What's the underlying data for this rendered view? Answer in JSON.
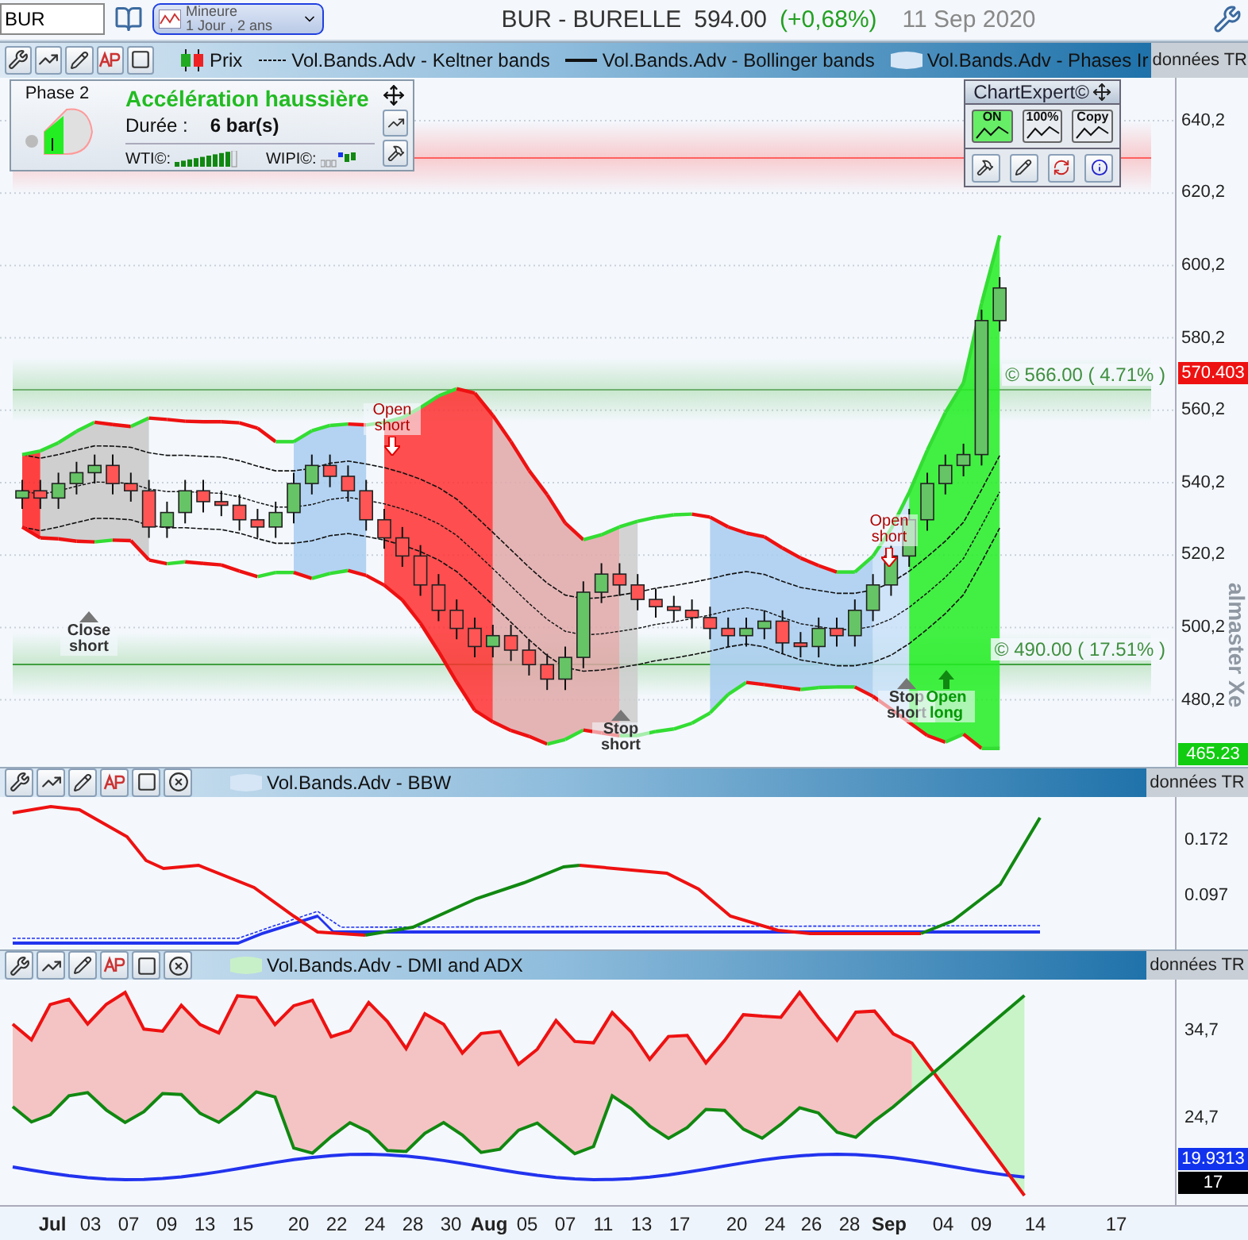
{
  "header": {
    "symbol": "BUR",
    "timeframe": {
      "label": "Mineure",
      "detail": "1 Jour , 2 ans"
    },
    "title": "BUR - BURELLE",
    "price": "594.00",
    "change": "(+0,68%)",
    "date": "11 Sep 2020"
  },
  "main_pane": {
    "legend": [
      {
        "kind": "candles",
        "label": "Prix"
      },
      {
        "kind": "dashed",
        "label": "Vol.Bands.Adv - Keltner bands"
      },
      {
        "kind": "solid",
        "label": "Vol.Bands.Adv - Bollinger bands"
      },
      {
        "kind": "area",
        "label": "Vol.Bands.Adv - Phases Ir"
      }
    ],
    "data_source": "données TR",
    "phase_panel": {
      "phase": "Phase 2",
      "title": "Accélération haussière",
      "duration_label": "Durée :",
      "duration": "6 bar(s)",
      "wti": {
        "label": "WTI©:",
        "level": 0.9
      },
      "wipi_label": "WIPI©:"
    },
    "chart_expert": {
      "title": "ChartExpert©",
      "buttons": [
        {
          "label": "ON",
          "on": true
        },
        {
          "label": "100%",
          "on": false
        },
        {
          "label": "Copy",
          "on": false
        }
      ]
    },
    "levels": [
      {
        "kind": "target",
        "label": "© 566.00 ( 4.71% )"
      },
      {
        "kind": "stop",
        "label": "© 490.00 ( 17.51% )"
      }
    ],
    "signals": [
      {
        "kind": "close_short",
        "label": "Close short"
      },
      {
        "kind": "open_short",
        "label": "Open short"
      },
      {
        "kind": "stop_short",
        "label": "Stop short"
      },
      {
        "kind": "open_short",
        "label": "Open short"
      },
      {
        "kind": "stop_short",
        "label": "Stop short"
      },
      {
        "kind": "open_long",
        "label": "Open long"
      }
    ],
    "y_axis": [
      "640,2",
      "620,2",
      "600,2",
      "580,2",
      "560,2",
      "540,2",
      "520,2",
      "500,2",
      "480,2"
    ],
    "price_tags": [
      {
        "kind": "resistance",
        "label": "570.403"
      },
      {
        "kind": "support",
        "label": "465.23"
      }
    ],
    "vendor_label": "almaster Xe"
  },
  "bbw_pane": {
    "legend": "Vol.Bands.Adv - BBW",
    "data_source": "données TR",
    "y_axis": [
      "0.172",
      "0.097"
    ]
  },
  "dmi_pane": {
    "legend": "Vol.Bands.Adv - DMI and ADX",
    "data_source": "données TR",
    "y_axis": [
      "34,7",
      "24,7"
    ],
    "value_tags": [
      {
        "kind": "adx",
        "label": "19.9313"
      },
      {
        "kind": "period",
        "label": "17"
      }
    ]
  },
  "x_axis": [
    {
      "label": "Jul",
      "month": true
    },
    {
      "label": "03",
      "month": false
    },
    {
      "label": "07",
      "month": false
    },
    {
      "label": "09",
      "month": false
    },
    {
      "label": "13",
      "month": false
    },
    {
      "label": "15",
      "month": false
    },
    {
      "label": "20",
      "month": false
    },
    {
      "label": "22",
      "month": false
    },
    {
      "label": "24",
      "month": false
    },
    {
      "label": "28",
      "month": false
    },
    {
      "label": "30",
      "month": false
    },
    {
      "label": "Aug",
      "month": true
    },
    {
      "label": "05",
      "month": false
    },
    {
      "label": "07",
      "month": false
    },
    {
      "label": "11",
      "month": false
    },
    {
      "label": "13",
      "month": false
    },
    {
      "label": "17",
      "month": false
    },
    {
      "label": "20",
      "month": false
    },
    {
      "label": "24",
      "month": false
    },
    {
      "label": "26",
      "month": false
    },
    {
      "label": "28",
      "month": false
    },
    {
      "label": "Sep",
      "month": true
    },
    {
      "label": "04",
      "month": false
    },
    {
      "label": "09",
      "month": false
    },
    {
      "label": "14",
      "month": false
    },
    {
      "label": "17",
      "month": false
    }
  ]
}
